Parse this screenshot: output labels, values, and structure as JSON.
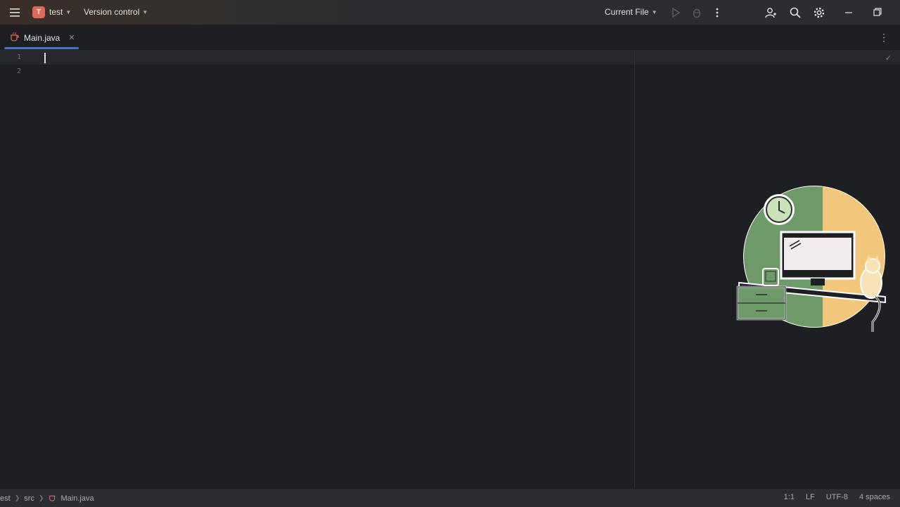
{
  "titlebar": {
    "project_badge": "T",
    "project_name": "test",
    "vcs_label": "Version control",
    "run_config": "Current File",
    "icons": [
      "hamburger-icon",
      "run-icon",
      "debug-icon",
      "more-vert-icon",
      "add-user-icon",
      "search-icon",
      "settings-icon",
      "minimize-icon",
      "restore-icon"
    ]
  },
  "tabs": [
    {
      "label": "Main.java",
      "active": true
    }
  ],
  "editor": {
    "line_numbers": [
      "1",
      "2"
    ]
  },
  "status": {
    "crumbs": [
      "test",
      "src",
      "Main.java"
    ],
    "position": "1:1",
    "line_sep": "LF",
    "encoding": "UTF-8",
    "indent": "4 spaces"
  },
  "colors": {
    "accent": "#3574f0",
    "project_badge": "#e0685a",
    "illustration_green": "#6e9a6a",
    "illustration_yellow": "#f2c77c"
  }
}
